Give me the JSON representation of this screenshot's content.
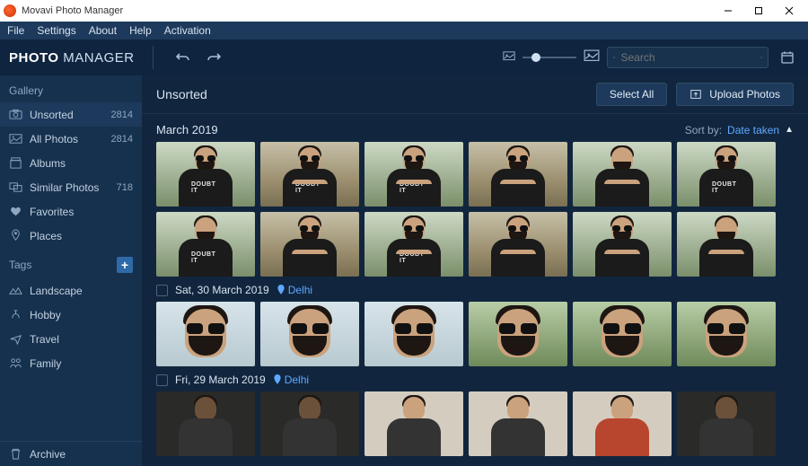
{
  "window": {
    "title": "Movavi Photo Manager"
  },
  "menu": {
    "file": "File",
    "settings": "Settings",
    "about": "About",
    "help": "Help",
    "activation": "Activation"
  },
  "brand": {
    "a": "PHOTO ",
    "b": "MANAGER"
  },
  "search": {
    "placeholder": "Search"
  },
  "sidebar": {
    "gallery_label": "Gallery",
    "items": [
      {
        "label": "Unsorted",
        "count": "2814"
      },
      {
        "label": "All Photos",
        "count": "2814"
      },
      {
        "label": "Albums",
        "count": ""
      },
      {
        "label": "Similar Photos",
        "count": "718"
      },
      {
        "label": "Favorites",
        "count": ""
      },
      {
        "label": "Places",
        "count": ""
      }
    ],
    "tags_label": "Tags",
    "tags": [
      {
        "label": "Landscape"
      },
      {
        "label": "Hobby"
      },
      {
        "label": "Travel"
      },
      {
        "label": "Family"
      }
    ],
    "archive": "Archive"
  },
  "content": {
    "title": "Unsorted",
    "select_all": "Select All",
    "upload": "Upload Photos",
    "sort_label": "Sort by:",
    "sort_value": "Date taken",
    "month": "March 2019",
    "groups": [
      {
        "date": "Sat, 30 March 2019",
        "place": "Delhi"
      },
      {
        "date": "Fri, 29 March 2019",
        "place": "Delhi"
      }
    ],
    "shirt_text": "DOUBT IT"
  }
}
